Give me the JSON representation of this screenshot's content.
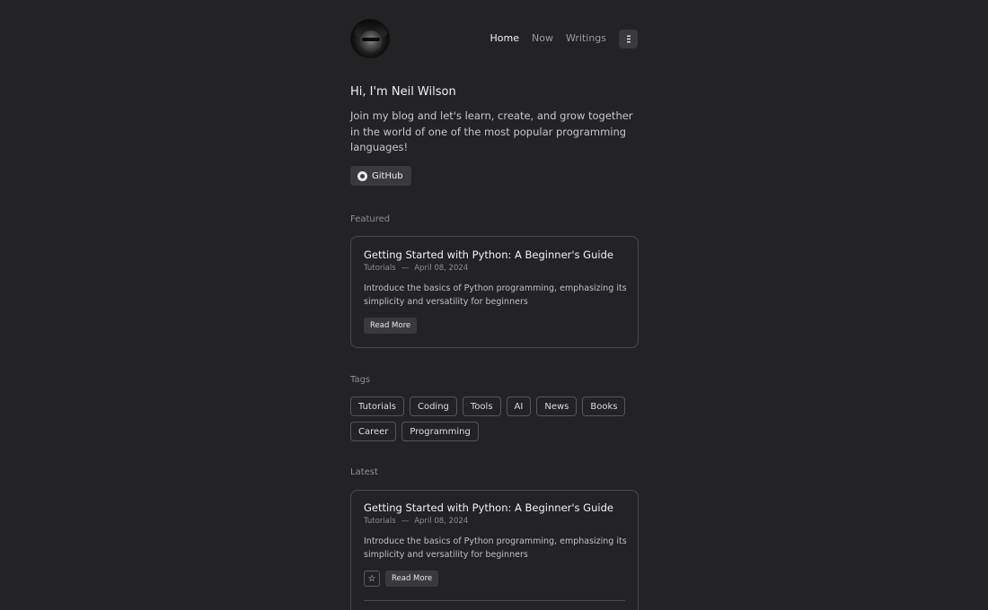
{
  "header": {
    "nav": [
      {
        "label": "Home",
        "active": true
      },
      {
        "label": "Now",
        "active": false
      },
      {
        "label": "Writings",
        "active": false
      }
    ],
    "menu_icon": "hamburger-icon"
  },
  "intro": {
    "greeting": "Hi, I'm Neil Wilson",
    "text": "Join my blog and let's learn, create, and grow together in the world of one of the most popular programming languages!",
    "github_label": "GitHub"
  },
  "featured": {
    "heading": "Featured",
    "post": {
      "title": "Getting Started with Python: A Beginner's Guide",
      "category": "Tutorials",
      "separator": "—",
      "date": "April 08, 2024",
      "description": "Introduce the basics of Python programming, emphasizing its simplicity and versatility for beginners",
      "read_more": "Read More"
    }
  },
  "tags": {
    "heading": "Tags",
    "items": [
      "Tutorials",
      "Coding",
      "Tools",
      "AI",
      "News",
      "Books",
      "Career",
      "Programming"
    ]
  },
  "latest": {
    "heading": "Latest",
    "post": {
      "title": "Getting Started with Python: A Beginner's Guide",
      "category": "Tutorials",
      "separator": "—",
      "date": "April 08, 2024",
      "description": "Introduce the basics of Python programming, emphasizing its simplicity and versatility for beginners",
      "read_more": "Read More",
      "star_icon": "star-icon"
    }
  },
  "colors": {
    "background": "#232326",
    "button": "#3a3a3e",
    "border": "#48484d"
  }
}
